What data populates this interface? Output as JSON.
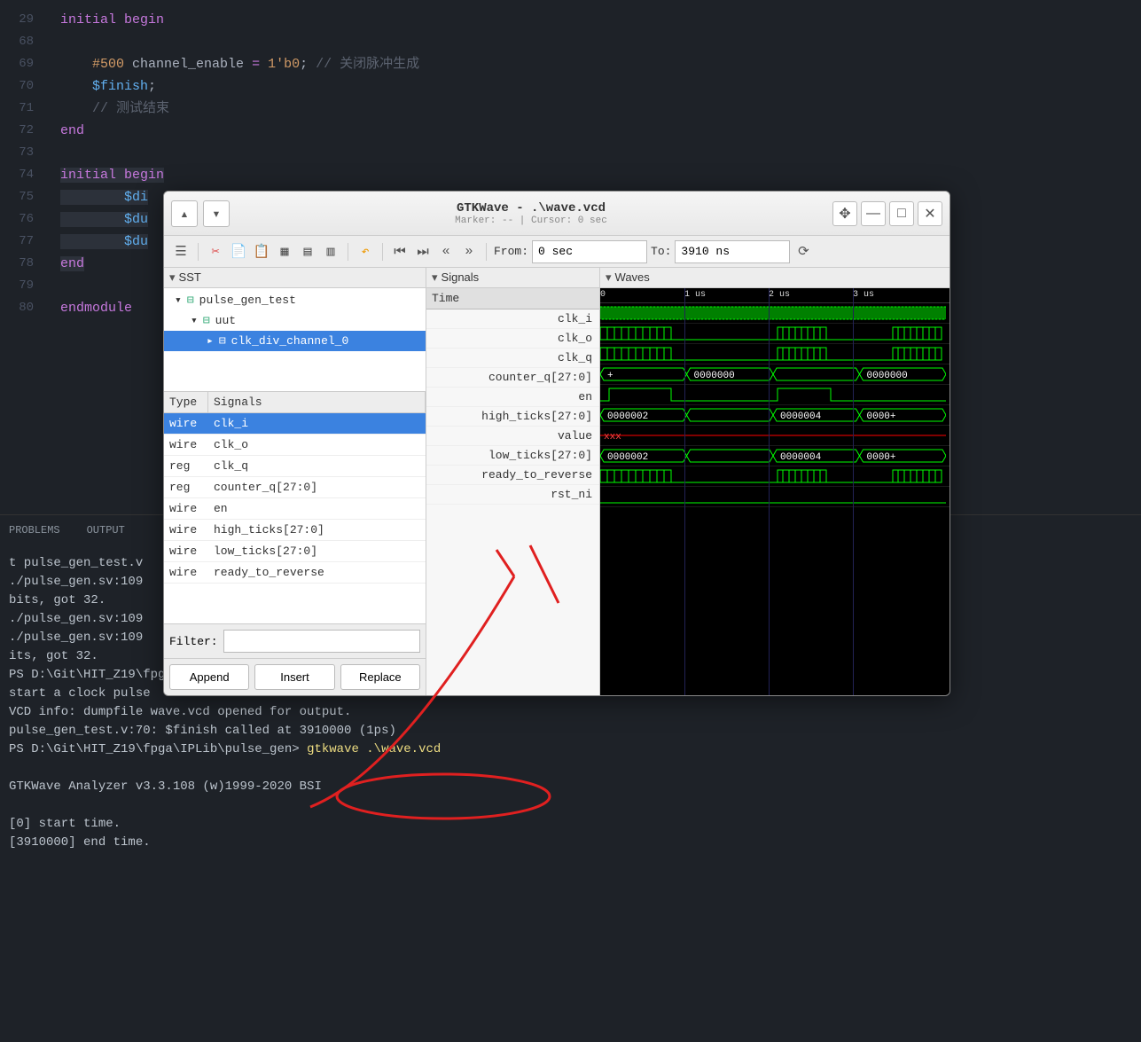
{
  "editor": {
    "lines": [
      {
        "n": 29,
        "html": "<span class='kw'>initial</span> <span class='kw'>begin</span>"
      },
      {
        "n": 68,
        "html": ""
      },
      {
        "n": 69,
        "html": "    <span class='num'>#500</span> channel_enable <span class='kw'>=</span> <span class='num'>1'b0</span>; <span class='cm'>// 关闭脉冲生成</span>"
      },
      {
        "n": 70,
        "html": "    <span class='fn'>$finish</span>;"
      },
      {
        "n": 71,
        "html": "    <span class='cm'>// 测试结束</span>"
      },
      {
        "n": 72,
        "html": "<span class='kw'>end</span>"
      },
      {
        "n": 73,
        "html": ""
      },
      {
        "n": 74,
        "html": "<span class='sel'><span class='kw'>initial</span> <span class='kw'>begin</span></span>"
      },
      {
        "n": 75,
        "html": "<span class='sel'>        <span class='fn'>$di</span></span>"
      },
      {
        "n": 76,
        "html": "<span class='sel'>        <span class='fn'>$du</span></span>"
      },
      {
        "n": 77,
        "html": "<span class='sel'>        <span class='fn'>$du</span></span>"
      },
      {
        "n": 78,
        "html": "<span class='sel'><span class='kw'>end</span></span>"
      },
      {
        "n": 79,
        "html": ""
      },
      {
        "n": 80,
        "html": "<span class='kw'>endmodule</span>"
      }
    ]
  },
  "panel_tabs": [
    "PROBLEMS",
    "OUTPUT"
  ],
  "terminal": {
    "lines": [
      "t pulse_gen_test.v",
      "./pulse_gen.sv:109",
      "bits, got 32.",
      "./pulse_gen.sv:109",
      "./pulse_gen.sv:109",
      "its, got 32.",
      "PS D:\\Git\\HIT_Z19\\fpga\\IPLib\\pulse_gen> <CMD>vvp pulse_gen_test.v.out</CMD>",
      "start a clock pulse",
      "VCD info: dumpfile wave.vcd opened for output.",
      "pulse_gen_test.v:70: $finish called at 3910000 (1ps)",
      "PS D:\\Git\\HIT_Z19\\fpga\\IPLib\\pulse_gen> <CMD>gtkwave .\\wave.vcd</CMD>",
      "",
      "GTKWave Analyzer v3.3.108 (w)1999-2020 BSI",
      "",
      "[0] start time.",
      "[3910000] end time."
    ]
  },
  "gtk": {
    "title": "GTKWave - .\\wave.vcd",
    "subtitle": "Marker: -- | Cursor: 0 sec",
    "from_label": "From:",
    "from_value": "0 sec",
    "to_label": "To:",
    "to_value": "3910 ns",
    "sst_label": "SST",
    "tree": [
      {
        "label": "pulse_gen_test",
        "indent": 0,
        "exp": "▾",
        "sel": false
      },
      {
        "label": "uut",
        "indent": 1,
        "exp": "▾",
        "sel": false
      },
      {
        "label": "clk_div_channel_0",
        "indent": 2,
        "exp": "▸",
        "sel": true
      }
    ],
    "sig_type_hdr": "Type",
    "sig_name_hdr": "Signals",
    "signals_table": [
      {
        "type": "wire",
        "name": "clk_i",
        "sel": true
      },
      {
        "type": "wire",
        "name": "clk_o",
        "sel": false
      },
      {
        "type": "reg",
        "name": "clk_q",
        "sel": false
      },
      {
        "type": "reg",
        "name": "counter_q[27:0]",
        "sel": false
      },
      {
        "type": "wire",
        "name": "en",
        "sel": false
      },
      {
        "type": "wire",
        "name": "high_ticks[27:0]",
        "sel": false
      },
      {
        "type": "wire",
        "name": "low_ticks[27:0]",
        "sel": false
      },
      {
        "type": "wire",
        "name": "ready_to_reverse",
        "sel": false
      }
    ],
    "filter_label": "Filter:",
    "filter_value": "",
    "btn_append": "Append",
    "btn_insert": "Insert",
    "btn_replace": "Replace",
    "signals_panel_label": "Signals",
    "waves_panel_label": "Waves",
    "signals_list": [
      "Time",
      "clk_i",
      "clk_o",
      "clk_q",
      "counter_q[27:0]",
      "en",
      "high_ticks[27:0]",
      "value",
      "low_ticks[27:0]",
      "ready_to_reverse",
      "rst_ni"
    ],
    "wave_ticks": [
      "0",
      "1 us",
      "2 us",
      "3 us"
    ],
    "wave_bus_values": {
      "counter_q": [
        "+",
        "0000000",
        "",
        "0000000"
      ],
      "high_ticks": [
        "0000002",
        "",
        "0000004",
        "0000+"
      ],
      "value": [
        "xxx"
      ],
      "low_ticks": [
        "0000002",
        "",
        "0000004",
        "0000+"
      ]
    }
  }
}
